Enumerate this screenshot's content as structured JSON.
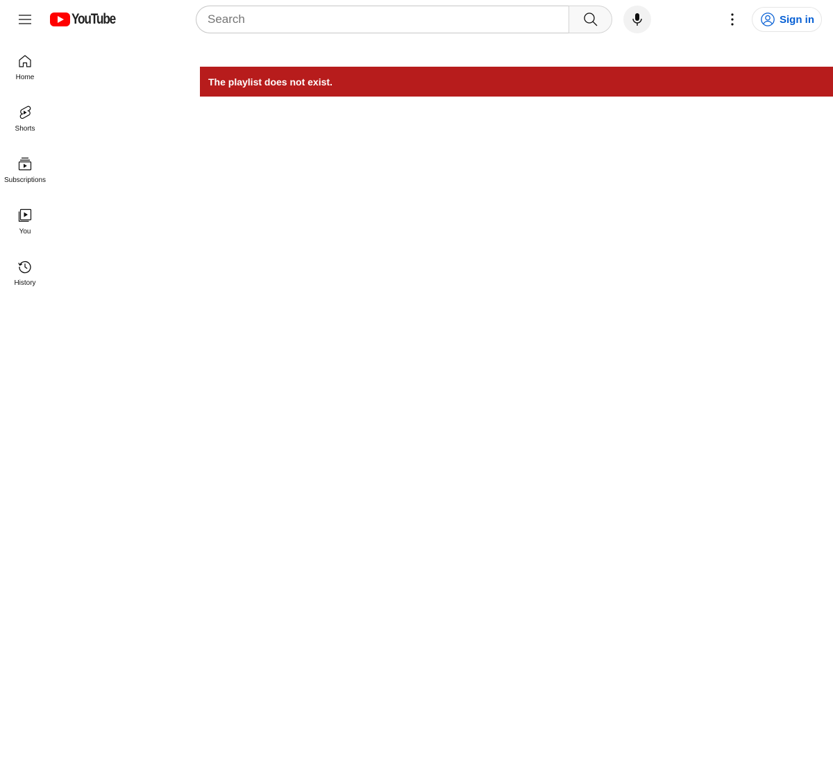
{
  "masthead": {
    "menu_icon": "hamburger-menu-icon",
    "logo_text": "YouTube",
    "search": {
      "placeholder": "Search",
      "value": ""
    },
    "search_icon": "search-icon",
    "mic_icon": "microphone-icon",
    "more_icon": "more-vertical-icon",
    "signin": {
      "label": "Sign in",
      "icon": "account-circle-icon"
    }
  },
  "guide": {
    "items": [
      {
        "label": "Home",
        "icon": "home-icon"
      },
      {
        "label": "Shorts",
        "icon": "shorts-icon"
      },
      {
        "label": "Subscriptions",
        "icon": "subscriptions-icon"
      },
      {
        "label": "You",
        "icon": "you-library-icon"
      },
      {
        "label": "History",
        "icon": "history-icon"
      }
    ]
  },
  "alert": {
    "message": "The playlist does not exist."
  },
  "colors": {
    "brand_red": "#ff0000",
    "alert_background": "#b71c1c",
    "link_blue": "#065fd4"
  }
}
